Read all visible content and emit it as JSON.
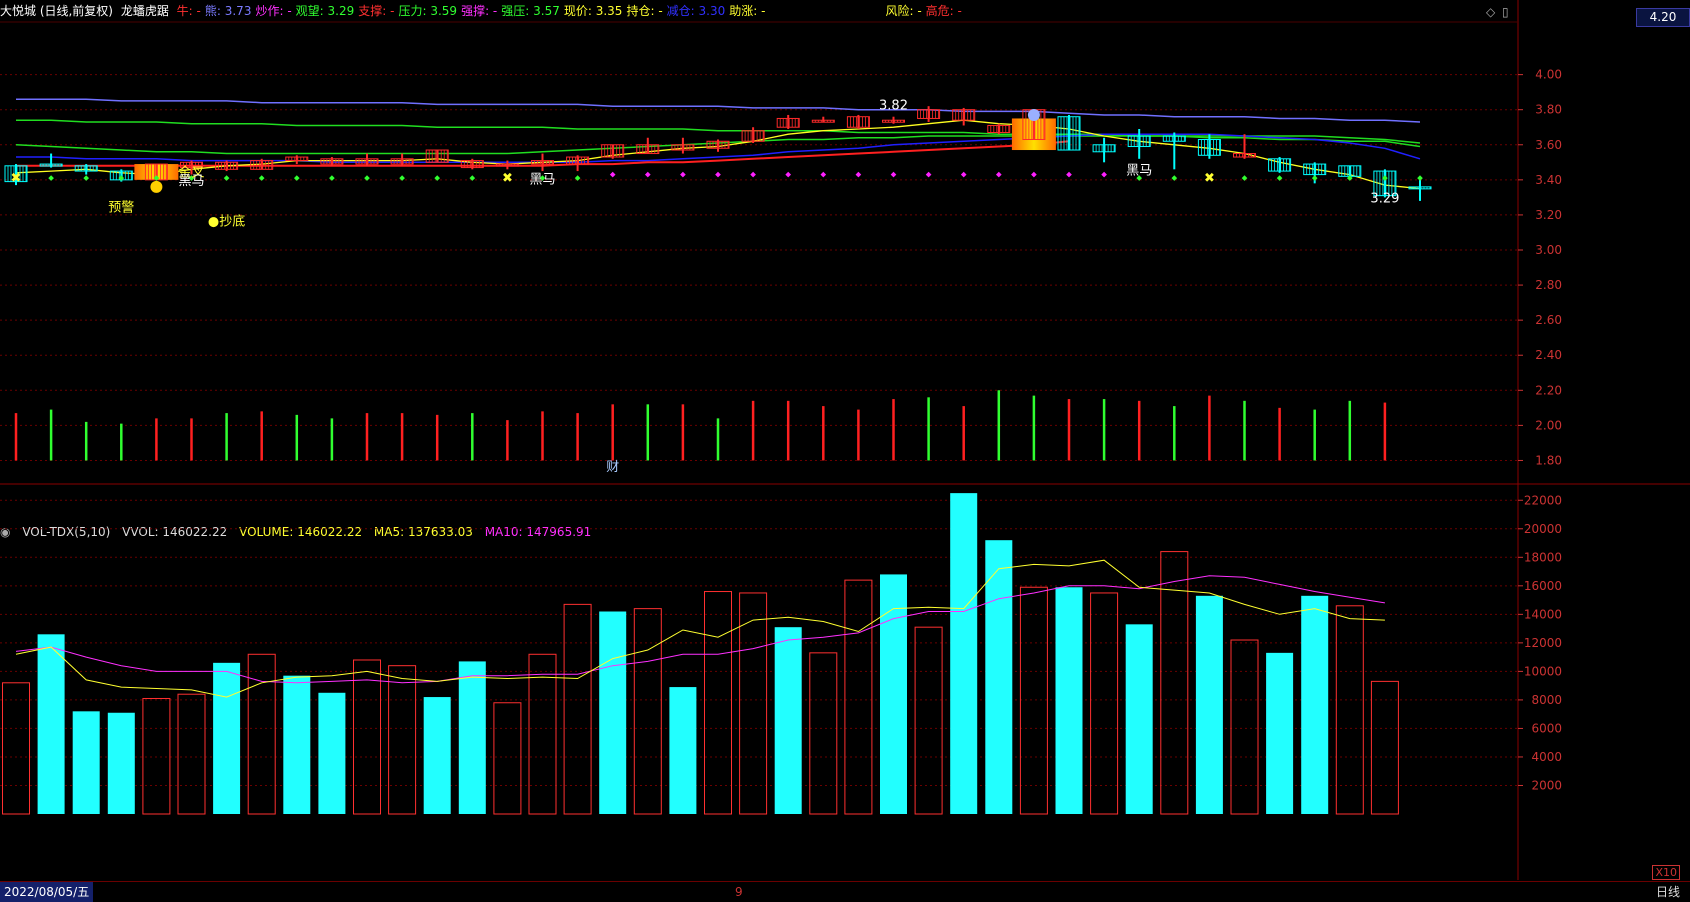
{
  "header": {
    "stock": "大悦城 (日线,前复权)",
    "indicator": "龙蟠虎踞",
    "items": [
      {
        "label": "牛:",
        "value": " -",
        "color": "#ff3030",
        "vcolor": "#ff3030"
      },
      {
        "label": "熊:",
        "value": " 3.73",
        "color": "#7b7bff",
        "vcolor": "#7b7bff"
      },
      {
        "label": "炒作:",
        "value": " -",
        "color": "#ff30ff",
        "vcolor": "#ff30ff"
      },
      {
        "label": "观望:",
        "value": " 3.29",
        "color": "#30ff30",
        "vcolor": "#30ff30"
      },
      {
        "label": "支撑:",
        "value": " -",
        "color": "#ff3030",
        "vcolor": "#ff3030"
      },
      {
        "label": "压力:",
        "value": " 3.59",
        "color": "#30ff30",
        "vcolor": "#30ff30"
      },
      {
        "label": "强撑:",
        "value": " -",
        "color": "#ff30ff",
        "vcolor": "#ff30ff"
      },
      {
        "label": "强压:",
        "value": " 3.57",
        "color": "#30ff30",
        "vcolor": "#30ff30"
      },
      {
        "label": "现价:",
        "value": " 3.35",
        "color": "#ffff30",
        "vcolor": "#ffff30"
      },
      {
        "label": "持仓:",
        "value": " -",
        "color": "#ffff30",
        "vcolor": "#ffff30"
      },
      {
        "label": "减仓:",
        "value": " 3.30",
        "color": "#3030ff",
        "vcolor": "#3030ff"
      },
      {
        "label": "助涨:",
        "value": " -",
        "color": "#ffff30",
        "vcolor": "#ffff30"
      },
      {
        "label": "风险:",
        "value": " -",
        "color": "#ffff30",
        "vcolor": "#ffff30"
      },
      {
        "label": "高危:",
        "value": " -",
        "color": "#ff3030",
        "vcolor": "#ff3030"
      }
    ],
    "current_axis_value": "4.20"
  },
  "volume_header": {
    "name": "VOL-TDX(5,10)",
    "vvol": "VVOL: 146022.22",
    "volume": "VOLUME: 146022.22",
    "ma5": "MA5: 137633.03",
    "ma10": "MA10: 147965.91"
  },
  "footer": {
    "date": "2022/08/05/五",
    "month_mark": "9",
    "period": "日线",
    "scale": "X10"
  },
  "colors": {
    "up": "#ff2a2a",
    "down": "#00ffff",
    "bull_line": "#7070ff",
    "bear_line": "#2020ff",
    "green_line": "#20dd20",
    "red_line": "#ff2020",
    "yellow_line": "#ffff20",
    "magenta": "#ff20ff",
    "grid": "#6a0000"
  },
  "chart_data": [
    {
      "type": "candlestick",
      "ylim": [
        1.7,
        4.3
      ],
      "yticks": [
        "4.00",
        "3.80",
        "3.60",
        "3.40",
        "3.20",
        "3.00",
        "2.80",
        "2.60",
        "2.40",
        "2.20",
        "2.00",
        "1.80"
      ],
      "candles": [
        {
          "o": 3.48,
          "c": 3.39,
          "h": 3.49,
          "l": 3.37
        },
        {
          "o": 3.49,
          "c": 3.48,
          "h": 3.55,
          "l": 3.47
        },
        {
          "o": 3.48,
          "c": 3.45,
          "h": 3.49,
          "l": 3.43
        },
        {
          "o": 3.45,
          "c": 3.4,
          "h": 3.46,
          "l": 3.39
        },
        {
          "o": 3.4,
          "c": 3.49,
          "h": 3.49,
          "l": 3.4
        },
        {
          "o": 3.47,
          "c": 3.5,
          "h": 3.51,
          "l": 3.43
        },
        {
          "o": 3.46,
          "c": 3.5,
          "h": 3.51,
          "l": 3.45
        },
        {
          "o": 3.46,
          "c": 3.51,
          "h": 3.52,
          "l": 3.46
        },
        {
          "o": 3.51,
          "c": 3.53,
          "h": 3.54,
          "l": 3.49
        },
        {
          "o": 3.49,
          "c": 3.52,
          "h": 3.53,
          "l": 3.48
        },
        {
          "o": 3.49,
          "c": 3.52,
          "h": 3.55,
          "l": 3.48
        },
        {
          "o": 3.49,
          "c": 3.52,
          "h": 3.55,
          "l": 3.48
        },
        {
          "o": 3.5,
          "c": 3.57,
          "h": 3.57,
          "l": 3.5
        },
        {
          "o": 3.47,
          "c": 3.51,
          "h": 3.52,
          "l": 3.46
        },
        {
          "o": 3.48,
          "c": 3.49,
          "h": 3.51,
          "l": 3.46
        },
        {
          "o": 3.49,
          "c": 3.51,
          "h": 3.55,
          "l": 3.45
        },
        {
          "o": 3.49,
          "c": 3.53,
          "h": 3.54,
          "l": 3.45
        },
        {
          "o": 3.53,
          "c": 3.6,
          "h": 3.6,
          "l": 3.52
        },
        {
          "o": 3.55,
          "c": 3.6,
          "h": 3.64,
          "l": 3.55
        },
        {
          "o": 3.57,
          "c": 3.6,
          "h": 3.64,
          "l": 3.55
        },
        {
          "o": 3.58,
          "c": 3.62,
          "h": 3.63,
          "l": 3.56
        },
        {
          "o": 3.62,
          "c": 3.68,
          "h": 3.7,
          "l": 3.61
        },
        {
          "o": 3.7,
          "c": 3.75,
          "h": 3.77,
          "l": 3.69
        },
        {
          "o": 3.74,
          "c": 3.74,
          "h": 3.76,
          "l": 3.73
        },
        {
          "o": 3.7,
          "c": 3.76,
          "h": 3.77,
          "l": 3.69
        },
        {
          "o": 3.74,
          "c": 3.74,
          "h": 3.76,
          "l": 3.72
        },
        {
          "o": 3.75,
          "c": 3.8,
          "h": 3.82,
          "l": 3.73
        },
        {
          "o": 3.74,
          "c": 3.8,
          "h": 3.81,
          "l": 3.71
        },
        {
          "o": 3.67,
          "c": 3.71,
          "h": 3.72,
          "l": 3.66
        },
        {
          "o": 3.63,
          "c": 3.8,
          "h": 3.8,
          "l": 3.63
        },
        {
          "o": 3.76,
          "c": 3.57,
          "h": 3.77,
          "l": 3.57
        },
        {
          "o": 3.6,
          "c": 3.56,
          "h": 3.64,
          "l": 3.5
        },
        {
          "o": 3.65,
          "c": 3.59,
          "h": 3.69,
          "l": 3.52
        },
        {
          "o": 3.65,
          "c": 3.62,
          "h": 3.67,
          "l": 3.46
        },
        {
          "o": 3.63,
          "c": 3.54,
          "h": 3.66,
          "l": 3.52
        },
        {
          "o": 3.53,
          "c": 3.55,
          "h": 3.66,
          "l": 3.52
        },
        {
          "o": 3.52,
          "c": 3.45,
          "h": 3.53,
          "l": 3.44
        },
        {
          "o": 3.49,
          "c": 3.43,
          "h": 3.5,
          "l": 3.38
        },
        {
          "o": 3.48,
          "c": 3.42,
          "h": 3.48,
          "l": 3.4
        },
        {
          "o": 3.45,
          "c": 3.31,
          "h": 3.46,
          "l": 3.3
        },
        {
          "o": 3.36,
          "c": 3.35,
          "h": 3.4,
          "l": 3.28
        }
      ],
      "bull_line": [
        3.86,
        3.86,
        3.86,
        3.85,
        3.85,
        3.85,
        3.85,
        3.84,
        3.84,
        3.84,
        3.84,
        3.84,
        3.83,
        3.83,
        3.83,
        3.83,
        3.83,
        3.82,
        3.82,
        3.82,
        3.82,
        3.81,
        3.81,
        3.81,
        3.8,
        3.8,
        3.8,
        3.79,
        3.79,
        3.79,
        3.78,
        3.77,
        3.77,
        3.76,
        3.76,
        3.76,
        3.75,
        3.75,
        3.74,
        3.74,
        3.73
      ],
      "bear_line": [
        3.53,
        3.53,
        3.52,
        3.52,
        3.52,
        3.51,
        3.51,
        3.51,
        3.51,
        3.5,
        3.5,
        3.5,
        3.5,
        3.5,
        3.5,
        3.5,
        3.5,
        3.51,
        3.51,
        3.52,
        3.53,
        3.54,
        3.56,
        3.57,
        3.58,
        3.6,
        3.61,
        3.62,
        3.63,
        3.64,
        3.65,
        3.66,
        3.66,
        3.66,
        3.66,
        3.65,
        3.64,
        3.63,
        3.61,
        3.58,
        3.52
      ],
      "green_line": [
        3.6,
        3.59,
        3.58,
        3.57,
        3.56,
        3.56,
        3.55,
        3.55,
        3.55,
        3.55,
        3.55,
        3.55,
        3.55,
        3.55,
        3.55,
        3.56,
        3.57,
        3.58,
        3.59,
        3.6,
        3.61,
        3.62,
        3.63,
        3.63,
        3.64,
        3.64,
        3.65,
        3.65,
        3.65,
        3.65,
        3.65,
        3.65,
        3.65,
        3.65,
        3.65,
        3.65,
        3.65,
        3.65,
        3.64,
        3.63,
        3.61
      ],
      "green_line2": [
        3.74,
        3.74,
        3.73,
        3.73,
        3.73,
        3.72,
        3.72,
        3.72,
        3.71,
        3.71,
        3.71,
        3.71,
        3.7,
        3.7,
        3.7,
        3.7,
        3.69,
        3.69,
        3.69,
        3.69,
        3.68,
        3.68,
        3.68,
        3.68,
        3.67,
        3.67,
        3.67,
        3.67,
        3.66,
        3.66,
        3.66,
        3.66,
        3.65,
        3.65,
        3.64,
        3.64,
        3.63,
        3.63,
        3.62,
        3.62,
        3.59
      ],
      "red_line": [
        3.48,
        3.48,
        3.48,
        3.48,
        3.48,
        3.48,
        3.48,
        3.48,
        3.48,
        3.48,
        3.48,
        3.48,
        3.48,
        3.48,
        3.48,
        3.48,
        3.49,
        3.49,
        3.5,
        3.5,
        3.51,
        3.52,
        3.53,
        3.54,
        3.55,
        3.56,
        3.57,
        3.58,
        3.59,
        3.6,
        3.62
      ],
      "yellow_line": [
        3.44,
        3.45,
        3.46,
        3.44,
        3.43,
        3.46,
        3.48,
        3.49,
        3.51,
        3.51,
        3.51,
        3.51,
        3.52,
        3.5,
        3.49,
        3.5,
        3.51,
        3.54,
        3.56,
        3.58,
        3.59,
        3.62,
        3.66,
        3.68,
        3.69,
        3.7,
        3.72,
        3.74,
        3.72,
        3.71,
        3.69,
        3.65,
        3.62,
        3.6,
        3.58,
        3.55,
        3.5,
        3.46,
        3.43,
        3.37,
        3.35
      ],
      "dots": [
        "yellow-x",
        "green",
        "green",
        "green",
        "green",
        "green",
        "green",
        "green",
        "green",
        "green",
        "green",
        "green",
        "green",
        "green",
        "yellow-x",
        "green",
        "green",
        "magenta",
        "magenta",
        "magenta",
        "magenta",
        "magenta",
        "magenta",
        "magenta",
        "magenta",
        "magenta",
        "magenta",
        "magenta",
        "magenta",
        "magenta",
        "magenta",
        "magenta",
        "green",
        "green",
        "yellow-x",
        "green",
        "green",
        "green",
        "green",
        "green",
        "green"
      ],
      "signal_bars": [
        {
          "c": "r",
          "h": 2.07
        },
        {
          "c": "g",
          "h": 2.09
        },
        {
          "c": "g",
          "h": 2.02
        },
        {
          "c": "g",
          "h": 2.01
        },
        {
          "c": "r",
          "h": 2.04
        },
        {
          "c": "r",
          "h": 2.04
        },
        {
          "c": "g",
          "h": 2.07
        },
        {
          "c": "r",
          "h": 2.08
        },
        {
          "c": "g",
          "h": 2.06
        },
        {
          "c": "g",
          "h": 2.04
        },
        {
          "c": "r",
          "h": 2.07
        },
        {
          "c": "r",
          "h": 2.07
        },
        {
          "c": "r",
          "h": 2.06
        },
        {
          "c": "g",
          "h": 2.07
        },
        {
          "c": "r",
          "h": 2.03
        },
        {
          "c": "r",
          "h": 2.08
        },
        {
          "c": "r",
          "h": 2.07
        },
        {
          "c": "r",
          "h": 2.12
        },
        {
          "c": "g",
          "h": 2.12
        },
        {
          "c": "r",
          "h": 2.12
        },
        {
          "c": "g",
          "h": 2.04
        },
        {
          "c": "r",
          "h": 2.14
        },
        {
          "c": "r",
          "h": 2.14
        },
        {
          "c": "r",
          "h": 2.11
        },
        {
          "c": "r",
          "h": 2.09
        },
        {
          "c": "r",
          "h": 2.15
        },
        {
          "c": "g",
          "h": 2.16
        },
        {
          "c": "r",
          "h": 2.11
        },
        {
          "c": "g",
          "h": 2.2
        },
        {
          "c": "g",
          "h": 2.17
        },
        {
          "c": "r",
          "h": 2.15
        },
        {
          "c": "g",
          "h": 2.15
        },
        {
          "c": "r",
          "h": 2.14
        },
        {
          "c": "g",
          "h": 2.11
        },
        {
          "c": "r",
          "h": 2.17
        },
        {
          "c": "g",
          "h": 2.14
        },
        {
          "c": "r",
          "h": 2.1
        },
        {
          "c": "g",
          "h": 2.09
        },
        {
          "c": "g",
          "h": 2.14
        },
        {
          "c": "r",
          "h": 2.13
        }
      ],
      "annotations": [
        {
          "text": "金叉",
          "i": 5,
          "v": 3.42,
          "color": "#ffff30"
        },
        {
          "text": "黑马",
          "i": 5,
          "v": 3.37,
          "color": "#ffffff"
        },
        {
          "text": "黑马",
          "i": 15,
          "v": 3.38,
          "color": "#ffffff"
        },
        {
          "text": "黑马",
          "i": 32,
          "v": 3.43,
          "color": "#ffffff"
        },
        {
          "text": "预警",
          "i": 3,
          "v": 3.22,
          "color": "#ffff30"
        },
        {
          "text": "●抄底",
          "i": 6,
          "v": 3.14,
          "color": "#ffff30"
        },
        {
          "text": "财",
          "i": 17,
          "v": 1.74,
          "color": "#aaccff"
        },
        {
          "text": "3.82",
          "i": 25,
          "v": 3.8,
          "color": "#ffffff"
        },
        {
          "text": "3.29",
          "i": 39,
          "v": 3.27,
          "color": "#ffffff"
        }
      ]
    },
    {
      "type": "bar",
      "ylim": [
        0,
        23000
      ],
      "yticks": [
        "22000",
        "20000",
        "18000",
        "16000",
        "14000",
        "12000",
        "10000",
        "8000",
        "6000",
        "4000",
        "2000"
      ],
      "values": [
        9200,
        12600,
        7200,
        7100,
        8100,
        8400,
        10600,
        11200,
        9700,
        8500,
        10800,
        10400,
        8200,
        10700,
        7800,
        11200,
        14700,
        14200,
        14400,
        8900,
        15600,
        15500,
        13100,
        11300,
        16400,
        16800,
        13100,
        22500,
        19200,
        15900,
        15900,
        15500,
        13300,
        18400,
        15300,
        12200,
        11300,
        15300,
        14600,
        9300
      ],
      "up": [
        1,
        0,
        0,
        0,
        1,
        1,
        0,
        1,
        0,
        0,
        1,
        1,
        0,
        0,
        1,
        1,
        1,
        0,
        1,
        0,
        1,
        1,
        0,
        1,
        1,
        0,
        1,
        0,
        0,
        1,
        0,
        1,
        0,
        1,
        0,
        1,
        0,
        0,
        1,
        1
      ],
      "ma5": [
        11200,
        11700,
        9400,
        8900,
        8800,
        8700,
        8200,
        9200,
        9600,
        9700,
        10000,
        9500,
        9300,
        9600,
        9500,
        9600,
        9500,
        10900,
        11500,
        12900,
        12400,
        13600,
        13800,
        13500,
        12800,
        14400,
        14500,
        14400,
        17200,
        17500,
        17400,
        17800,
        15900,
        15700,
        15500,
        14700,
        14000,
        14400,
        13700,
        13600
      ],
      "ma10": [
        11400,
        11700,
        11000,
        10400,
        10000,
        10000,
        10000,
        9300,
        9200,
        9300,
        9400,
        9200,
        9300,
        9700,
        9700,
        9800,
        9800,
        10400,
        10700,
        11200,
        11200,
        11600,
        12200,
        12400,
        12700,
        13700,
        14200,
        14200,
        15100,
        15500,
        16000,
        16000,
        15800,
        16300,
        16700,
        16600,
        16100,
        15600,
        15200,
        14800
      ]
    }
  ]
}
